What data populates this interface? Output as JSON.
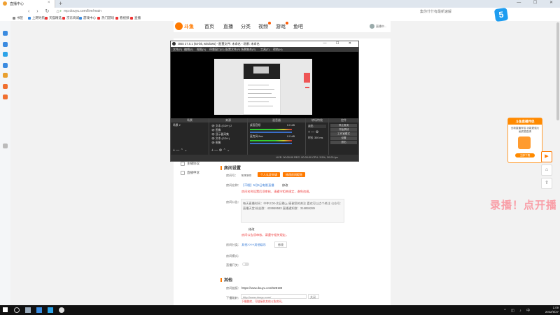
{
  "browser": {
    "tab_title": "直播中心",
    "new_tab": "+",
    "window_controls": "— ☐ ✕",
    "nav_icons": "‹ › ↻ ⌂",
    "url": "mp.douyu.com/live/main",
    "addr_right": "集你什什有最新速解",
    "bookmarks": [
      "书签",
      "上网导航",
      "天猫精选",
      "京东商城",
      "游戏中心",
      "热门游戏",
      "看视频",
      "直播"
    ]
  },
  "site": {
    "logo": "斗鱼",
    "nav": [
      "首页",
      "直播",
      "分类",
      "视频",
      "游戏",
      "鱼吧"
    ],
    "user": "直播中..."
  },
  "leftmenu": [
    "主播协议",
    "直播申诉"
  ],
  "room": {
    "section_title": "房间设置",
    "room_id_label": "房间号：",
    "room_id": "528183",
    "btn_apply": "个人认证申请",
    "btn_modify": "修改房间昵称",
    "name_label": "房间名称：",
    "name_value": "【不眠】5月5日电影直播",
    "name_edit": "修改",
    "name_hint": "房间名称设置后须审核，请遵守相关规定，避免违规。",
    "notice_label": "房间公告：",
    "notice_text": "每天直播时间：中午2:00-次日晚上 感谢您的关注 喜欢可以点个关注 公众号:直播天堂 粉丝群：428959583 直播通知群：316859289",
    "notice_edit": "修改",
    "notice_hint": "房间公告须审核，请遵守相关规定。",
    "cat_label": "房间分类：",
    "cat_value": "其他>>>>其他娱乐",
    "cat_edit": "修改",
    "mode_label": "房间模式：",
    "mode_toggle": "直播开关："
  },
  "other": {
    "section_title": "其他",
    "link_label": "房间链接：",
    "link_value": "https://www.douyu.com/528183",
    "jump_label": "下播跳转：",
    "jump_placeholder": "http://www.douyu.com/",
    "jump_select": "关闭",
    "jump_hint": "下播跳转，可链接到其他斗鱼房间。"
  },
  "obs": {
    "title": "OBS 27.0.1 (64-bit, windows) - 配置文件: 未命名 - 场景: 未命名",
    "menu": [
      "文件(F)",
      "编辑(E)",
      "视图(V)",
      "停靠窗口(D)",
      "配置文件(P)",
      "场景集合(S)",
      "工具(T)",
      "帮助(H)"
    ],
    "dock_titles": [
      "场景",
      "来源",
      "混音器",
      "转场特效",
      "控件"
    ],
    "scene": "场景 2",
    "sources": [
      "文本 (GDI+) 2",
      "图像",
      "显示器采集",
      "文本 (GDI+)",
      "图像"
    ],
    "mixer": [
      "桌面音频",
      "麦克风/Aux"
    ],
    "mixer_levels": [
      "0.0 dB",
      "0.0 dB"
    ],
    "transition": "淡出",
    "duration_label": "时长",
    "duration": "300 ms",
    "controls": [
      "停止推流",
      "开始录制",
      "工作室模式",
      "设置",
      "退出"
    ],
    "status": "LIVE: 00:00:00   REC: 00:00:00   CPU: 3.5%, 30.00 fps"
  },
  "ad": {
    "header": "斗鱼直播伴侣",
    "sub": "全新直播伴侣 功能更强大 画质更高清",
    "button": "立即下载"
  },
  "right_buttons": [
    "▶",
    "⌂",
    "⇪"
  ],
  "overlay_text": "录播！点开播",
  "logo_badge": "5",
  "taskbar": {
    "time": "1:09",
    "date": "2022/6/27",
    "tray": "^ ◫ ♪ 中"
  },
  "colors": {
    "accent": "#ff7a00",
    "link": "#3579d5",
    "warn": "#ee4444"
  }
}
